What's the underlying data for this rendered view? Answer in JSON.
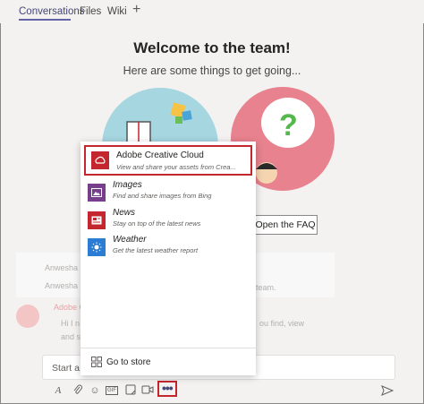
{
  "tabs": {
    "conversations": "Conversations",
    "files": "Files",
    "wiki": "Wiki",
    "add": "+"
  },
  "welcome": {
    "title": "Welcome to the team!",
    "subtitle": "Here are some things to get going...",
    "faq_button": "Open the FAQ"
  },
  "background_conversation": {
    "row1_name": "Anwesha Ch",
    "row2_name": "Anwesha Ch",
    "row3_name": "Adobe Cre",
    "row3_line1": "Hi I n",
    "row3_line2": "and s",
    "row2_tail": "team.",
    "row3_tail": "ou find, view"
  },
  "popup": {
    "items": [
      {
        "title": "Adobe Creative Cloud",
        "desc": "View and share your assets from Crea...",
        "icon": "creative-cloud-icon",
        "color": "#c4262e"
      },
      {
        "title": "Images",
        "desc": "Find and share images from Bing",
        "icon": "images-icon",
        "color": "#773f8b"
      },
      {
        "title": "News",
        "desc": "Stay on top of the latest news",
        "icon": "news-icon",
        "color": "#c4262e"
      },
      {
        "title": "Weather",
        "desc": "Get the latest weather report",
        "icon": "weather-icon",
        "color": "#2b7cd3"
      }
    ],
    "store_label": "Go to store"
  },
  "compose": {
    "placeholder": "Start a n"
  },
  "toolbar": {
    "format": "A",
    "attach": "⊘",
    "emoji": "☺",
    "gif": "GIF",
    "sticker": "▭",
    "meet": "▭",
    "more": "•••"
  },
  "colors": {
    "accent": "#6264a7",
    "highlight_border": "#c4262e"
  }
}
